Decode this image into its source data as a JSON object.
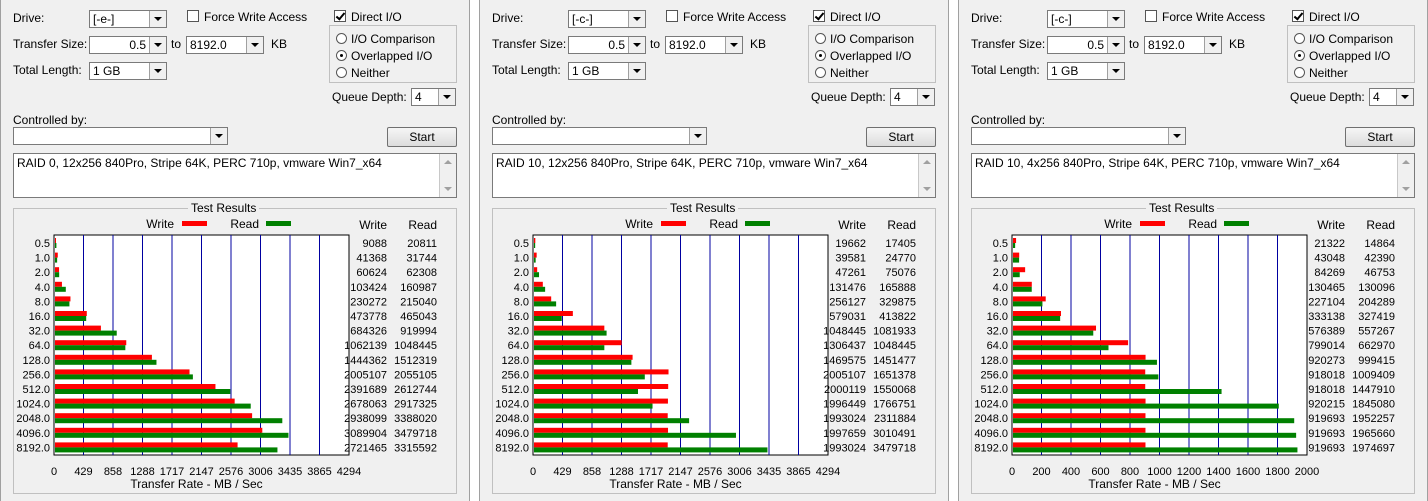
{
  "labels": {
    "drive": "Drive:",
    "transfer_size": "Transfer Size:",
    "to": "to",
    "kb": "KB",
    "total_length": "Total Length:",
    "force_write": "Force Write Access",
    "direct_io": "Direct I/O",
    "io_comparison": "I/O Comparison",
    "overlapped_io": "Overlapped I/O",
    "neither": "Neither",
    "queue_depth": "Queue Depth:",
    "controlled_by": "Controlled by:",
    "start": "Start",
    "test_results": "Test Results",
    "write": "Write",
    "read": "Read",
    "xlabel": "Transfer Rate - MB / Sec"
  },
  "colors": {
    "write": "#ff0000",
    "read": "#008000",
    "grid": "#0000a0"
  },
  "panels": [
    {
      "drive": "[-e-]",
      "transfer_from": "0.5",
      "transfer_to": "8192.0",
      "total_length": "1 GB",
      "queue_depth": "4",
      "force_write": false,
      "direct_io": true,
      "io_mode": "overlapped",
      "controlled_by": "",
      "description": "RAID 0, 12x256 840Pro, Stripe 64K, PERC 710p, vmware Win7_x64",
      "chart_data": {
        "type": "bar",
        "orientation": "horizontal",
        "categories": [
          "0.5",
          "1.0",
          "2.0",
          "4.0",
          "8.0",
          "16.0",
          "32.0",
          "64.0",
          "128.0",
          "256.0",
          "512.0",
          "1024.0",
          "2048.0",
          "4096.0",
          "8192.0"
        ],
        "series": [
          {
            "name": "Write",
            "values": [
              9088,
              41368,
              60624,
              103424,
              230272,
              473778,
              684326,
              1062139,
              1444362,
              2005107,
              2391689,
              2678063,
              2938099,
              3089904,
              2721465
            ]
          },
          {
            "name": "Read",
            "values": [
              20811,
              31744,
              62308,
              160987,
              215040,
              465043,
              919994,
              1048445,
              1512319,
              2055105,
              2612744,
              2917325,
              3388020,
              3479718,
              3315592
            ]
          }
        ],
        "xticks": [
          "0",
          "429",
          "858",
          "1288",
          "1717",
          "2147",
          "2576",
          "3006",
          "3435",
          "3865",
          "4294"
        ],
        "xlim": [
          0,
          4294
        ],
        "xlabel": "Transfer Rate - MB / Sec"
      }
    },
    {
      "drive": "[-c-]",
      "transfer_from": "0.5",
      "transfer_to": "8192.0",
      "total_length": "1 GB",
      "queue_depth": "4",
      "force_write": false,
      "direct_io": true,
      "io_mode": "overlapped",
      "controlled_by": "",
      "description": "RAID 10, 12x256 840Pro, Stripe 64K, PERC 710p, vmware Win7_x64",
      "chart_data": {
        "type": "bar",
        "orientation": "horizontal",
        "categories": [
          "0.5",
          "1.0",
          "2.0",
          "4.0",
          "8.0",
          "16.0",
          "32.0",
          "64.0",
          "128.0",
          "256.0",
          "512.0",
          "1024.0",
          "2048.0",
          "4096.0",
          "8192.0"
        ],
        "series": [
          {
            "name": "Write",
            "values": [
              19662,
              39581,
              47261,
              131476,
              256127,
              579031,
              1048445,
              1306437,
              1469575,
              2005107,
              2000119,
              1996449,
              1993024,
              1997659,
              1993024
            ]
          },
          {
            "name": "Read",
            "values": [
              17405,
              24770,
              75076,
              165888,
              329875,
              413822,
              1081933,
              1048445,
              1451477,
              1651378,
              1550068,
              1766751,
              2311884,
              3010491,
              3479718
            ]
          }
        ],
        "xticks": [
          "0",
          "429",
          "858",
          "1288",
          "1717",
          "2147",
          "2576",
          "3006",
          "3435",
          "3865",
          "4294"
        ],
        "xlim": [
          0,
          4294
        ],
        "xlabel": "Transfer Rate - MB / Sec"
      }
    },
    {
      "drive": "[-c-]",
      "transfer_from": "0.5",
      "transfer_to": "8192.0",
      "total_length": "1 GB",
      "queue_depth": "4",
      "force_write": false,
      "direct_io": true,
      "io_mode": "overlapped",
      "controlled_by": "",
      "description": "RAID 10, 4x256 840Pro, Stripe 64K, PERC 710p, vmware Win7_x64",
      "chart_data": {
        "type": "bar",
        "orientation": "horizontal",
        "categories": [
          "0.5",
          "1.0",
          "2.0",
          "4.0",
          "8.0",
          "16.0",
          "32.0",
          "64.0",
          "128.0",
          "256.0",
          "512.0",
          "1024.0",
          "2048.0",
          "4096.0",
          "8192.0"
        ],
        "series": [
          {
            "name": "Write",
            "values": [
              21322,
              43048,
              84269,
              130465,
              227104,
              333138,
              576389,
              799014,
              920273,
              918018,
              918018,
              920215,
              919693,
              919693,
              919693
            ]
          },
          {
            "name": "Read",
            "values": [
              14864,
              42390,
              46753,
              130096,
              204289,
              327419,
              557267,
              662970,
              999415,
              1009409,
              1447910,
              1845080,
              1952257,
              1965660,
              1974697
            ]
          }
        ],
        "xticks": [
          "0",
          "200",
          "400",
          "600",
          "800",
          "1000",
          "1200",
          "1400",
          "1600",
          "1800",
          "2000"
        ],
        "xlim": [
          0,
          2000
        ],
        "xlabel": "Transfer Rate - MB / Sec"
      }
    }
  ]
}
